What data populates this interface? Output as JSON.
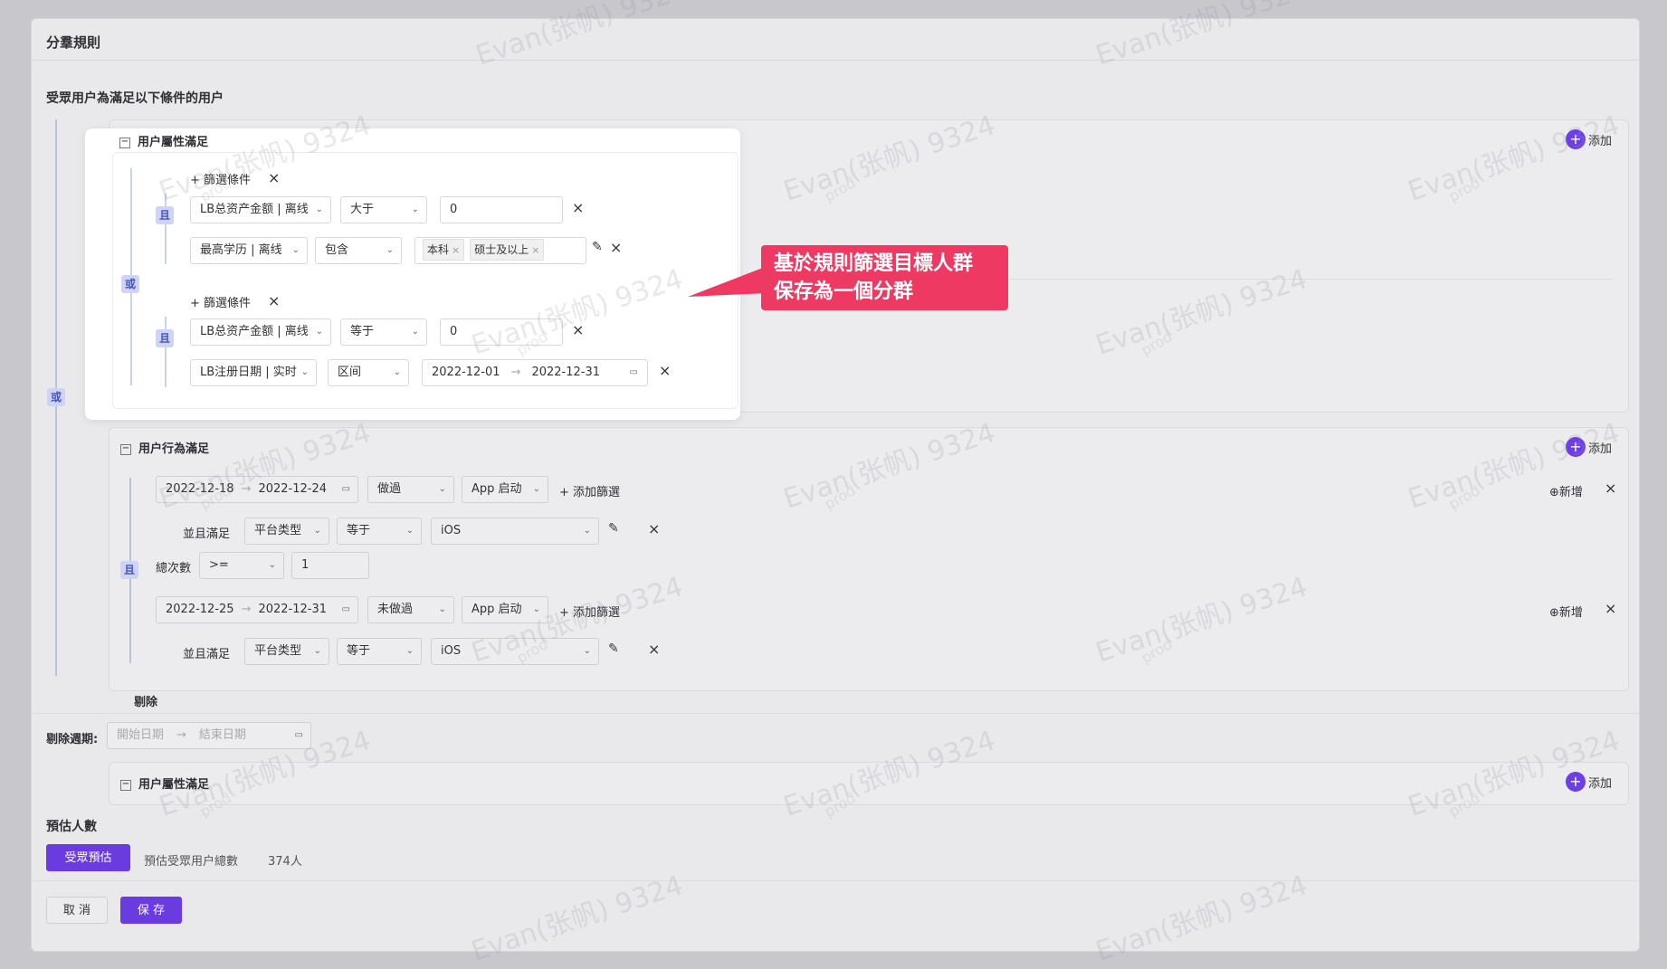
{
  "section_title": "分羣規則",
  "target_desc": "受眾用户為滿足以下條件的用户",
  "or_label": "或",
  "and_label": "且",
  "add_label": "添加",
  "new_label": "新增",
  "add_filter_label": "添加篩選",
  "filter_cond_label": "篩選條件",
  "attr_group": {
    "title": "用户屬性滿足",
    "subgroups": [
      {
        "rows": [
          {
            "field": "LB总资产金额 | 离线",
            "op": "大于",
            "value": "0"
          },
          {
            "field": "最高学历 | 离线",
            "op": "包含",
            "tags": [
              "本科",
              "硕士及以上"
            ]
          }
        ]
      },
      {
        "rows": [
          {
            "field": "LB总资产金额 | 离线",
            "op": "等于",
            "value": "0"
          },
          {
            "field": "LB注册日期 | 实时",
            "op": "区间",
            "date_start": "2022-12-01",
            "date_end": "2022-12-31"
          }
        ]
      }
    ]
  },
  "behavior_group": {
    "title": "用户行為滿足",
    "and_satisfy": "並且滿足",
    "total_count_label": "總次數",
    "total_count_op": ">=",
    "total_count_value": "1",
    "events": [
      {
        "date_start": "2022-12-18",
        "date_end": "2022-12-24",
        "action": "做過",
        "event": "App 启动",
        "sub_field": "平台类型",
        "sub_op": "等于",
        "sub_value": "iOS"
      },
      {
        "date_start": "2022-12-25",
        "date_end": "2022-12-31",
        "action": "未做過",
        "event": "App 启动",
        "sub_field": "平台类型",
        "sub_op": "等于",
        "sub_value": "iOS"
      }
    ]
  },
  "exclude": {
    "title": "剔除",
    "period_label": "剔除週期:",
    "start_placeholder": "開始日期",
    "end_placeholder": "結束日期",
    "attr_title": "用户屬性滿足"
  },
  "estimate": {
    "title": "預估人數",
    "button": "受眾預估",
    "total_label": "預估受眾用户總數",
    "total_value": "374人"
  },
  "footer": {
    "cancel": "取 消",
    "save": "保 存"
  },
  "callout": {
    "line1": "基於規則篩選目標人群",
    "line2": "保存為一個分群"
  },
  "watermark": {
    "main": "Evan(张帆) 9324",
    "sub": "prod"
  },
  "colors": {
    "primary": "#6a3ce0",
    "callout": "#ee3a62",
    "badge_bg": "#cfd3f4",
    "badge_text": "#4453c9"
  }
}
